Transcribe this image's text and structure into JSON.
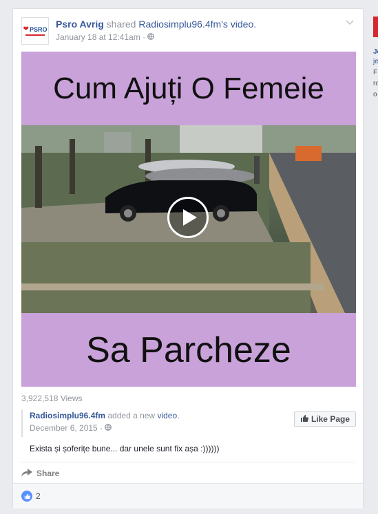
{
  "post": {
    "page_name": "Psro Avrig",
    "shared_word": "shared",
    "source_page": "Radiosimplu96.4fm",
    "source_suffix": "'s video.",
    "timestamp": "January 18 at 12:41am",
    "meta_sep": "·",
    "avatar_text": "PSRO"
  },
  "video": {
    "caption_top": "Cum Ajuți O Femeie",
    "caption_bottom": "Sa Parcheze"
  },
  "views": "3,922,518 Views",
  "shared_post": {
    "author": "Radiosimplu96.4fm",
    "action": "added a new",
    "object": "video.",
    "date": "December 6, 2015",
    "meta_sep": "·",
    "text": "Exista și șoferițe bune... dar unele sunt fix așa :))))))",
    "like_page_label": "Like Page"
  },
  "actions": {
    "share_label": "Share"
  },
  "reactions": {
    "count": "2"
  },
  "sidebar": {
    "lines": [
      "Je",
      "je",
      "F",
      "ro",
      "o"
    ]
  },
  "colors": {
    "link": "#365899",
    "meta": "#90949c",
    "caption_bg": "#c9a2da",
    "like_blue": "#5890ff"
  }
}
